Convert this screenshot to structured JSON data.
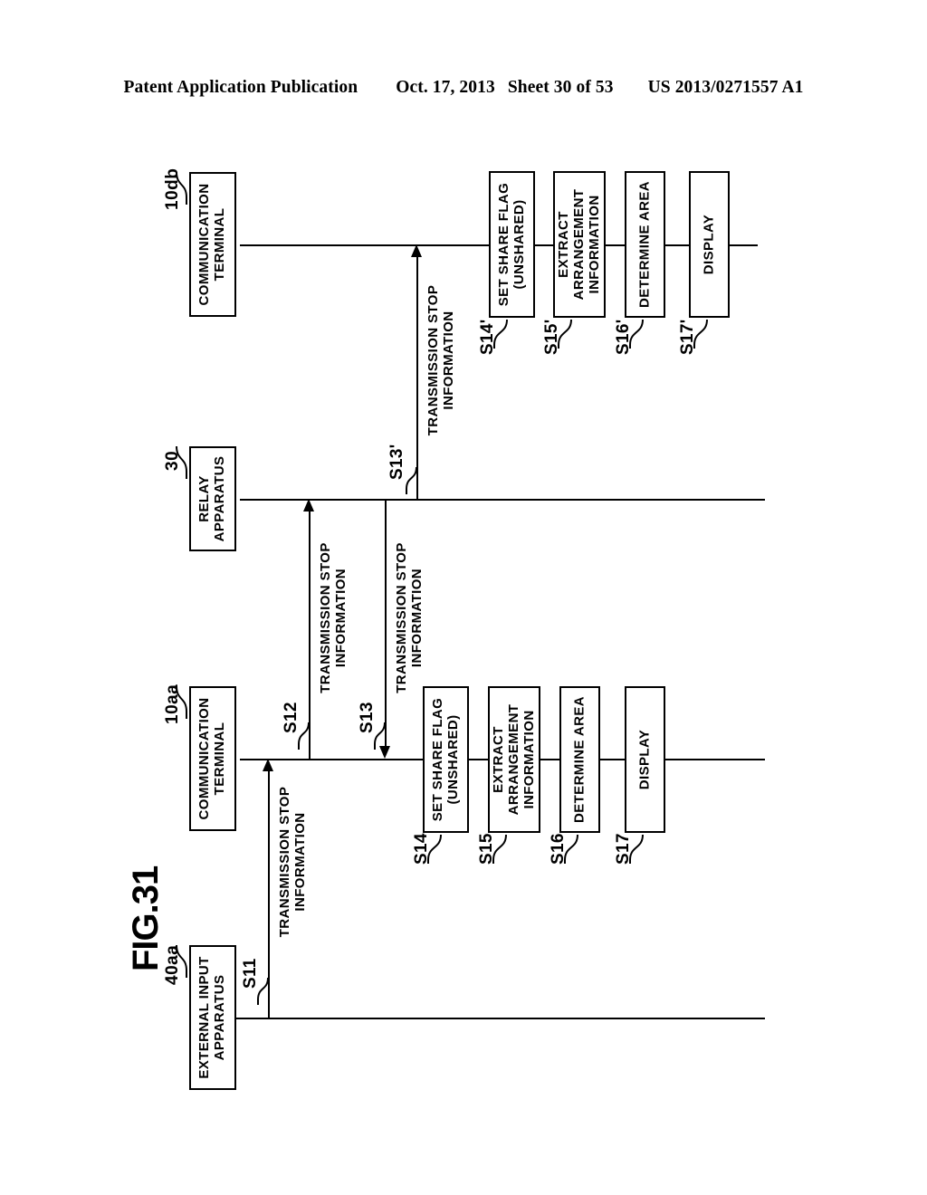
{
  "header": {
    "publication": "Patent Application Publication",
    "date": "Oct. 17, 2013",
    "sheet": "Sheet 30 of 53",
    "docnum": "US 2013/0271557 A1"
  },
  "figure": {
    "caption": "FIG.31",
    "lifelines": [
      {
        "ref": "10db",
        "label_line1": "COMMUNICATION",
        "label_line2": "TERMINAL"
      },
      {
        "ref": "30",
        "label_line1": "RELAY",
        "label_line2": "APPARATUS"
      },
      {
        "ref": "10aa",
        "label_line1": "COMMUNICATION",
        "label_line2": "TERMINAL"
      },
      {
        "ref": "40aa",
        "label_line1": "EXTERNAL  INPUT",
        "label_line2": "APPARATUS"
      }
    ],
    "messages": [
      {
        "step": "S11",
        "line1": "TRANSMISSION STOP",
        "line2": "INFORMATION",
        "direction": "up"
      },
      {
        "step": "S12",
        "line1": "TRANSMISSION STOP",
        "line2": "INFORMATION",
        "direction": "up"
      },
      {
        "step": "S13",
        "line1": "TRANSMISSION STOP",
        "line2": "INFORMATION",
        "direction": "down"
      },
      {
        "step": "S13'",
        "line1": "TRANSMISSION STOP",
        "line2": "INFORMATION",
        "direction": "up"
      }
    ],
    "processes_terminal_aa": [
      {
        "step": "S14",
        "line1": "SET SHARE FLAG",
        "line2": "(UNSHARED)",
        "line3": ""
      },
      {
        "step": "S15",
        "line1": "EXTRACT",
        "line2": "ARRANGEMENT",
        "line3": "INFORMATION"
      },
      {
        "step": "S16",
        "line1": "DETERMINE AREA",
        "line2": "",
        "line3": ""
      },
      {
        "step": "S17",
        "line1": "DISPLAY",
        "line2": "",
        "line3": ""
      }
    ],
    "processes_terminal_db": [
      {
        "step": "S14'",
        "line1": "SET SHARE FLAG",
        "line2": "(UNSHARED)",
        "line3": ""
      },
      {
        "step": "S15'",
        "line1": "EXTRACT",
        "line2": "ARRANGEMENT",
        "line3": "INFORMATION"
      },
      {
        "step": "S16'",
        "line1": "DETERMINE AREA",
        "line2": "",
        "line3": ""
      },
      {
        "step": "S17'",
        "line1": "DISPLAY",
        "line2": "",
        "line3": ""
      }
    ]
  }
}
